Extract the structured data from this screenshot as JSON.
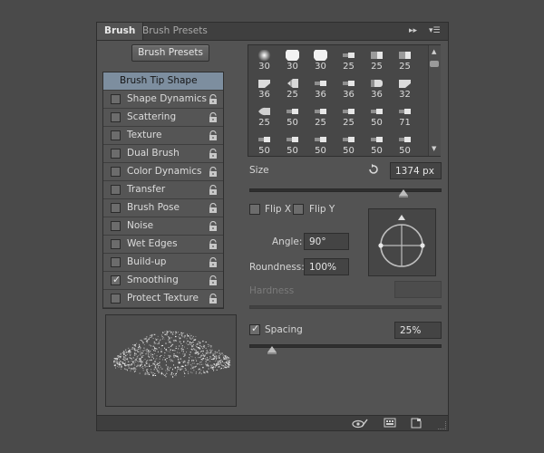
{
  "tabs": [
    {
      "label": "Brush",
      "active": true
    },
    {
      "label": "Brush Presets",
      "active": false
    }
  ],
  "panel_controls": {
    "collapse": "▸▸",
    "menu": "▾☰"
  },
  "brush_presets_button": "Brush Presets",
  "options": [
    {
      "label": "Brush Tip Shape",
      "selected": true,
      "checkbox": false,
      "checked": false,
      "lock": false
    },
    {
      "label": "Shape Dynamics",
      "selected": false,
      "checkbox": true,
      "checked": false,
      "lock": true
    },
    {
      "label": "Scattering",
      "selected": false,
      "checkbox": true,
      "checked": false,
      "lock": true
    },
    {
      "label": "Texture",
      "selected": false,
      "checkbox": true,
      "checked": false,
      "lock": true
    },
    {
      "label": "Dual Brush",
      "selected": false,
      "checkbox": true,
      "checked": false,
      "lock": true
    },
    {
      "label": "Color Dynamics",
      "selected": false,
      "checkbox": true,
      "checked": false,
      "lock": true
    },
    {
      "label": "Transfer",
      "selected": false,
      "checkbox": true,
      "checked": false,
      "lock": true
    },
    {
      "label": "Brush Pose",
      "selected": false,
      "checkbox": true,
      "checked": false,
      "lock": true
    },
    {
      "label": "Noise",
      "selected": false,
      "checkbox": true,
      "checked": false,
      "lock": true
    },
    {
      "label": "Wet Edges",
      "selected": false,
      "checkbox": true,
      "checked": false,
      "lock": true
    },
    {
      "label": "Build-up",
      "selected": false,
      "checkbox": true,
      "checked": false,
      "lock": true
    },
    {
      "label": "Smoothing",
      "selected": false,
      "checkbox": true,
      "checked": true,
      "lock": true
    },
    {
      "label": "Protect Texture",
      "selected": false,
      "checkbox": true,
      "checked": false,
      "lock": true
    }
  ],
  "brush_grid": {
    "rows": [
      [
        {
          "size": "30",
          "tip": "soft-round"
        },
        {
          "size": "30",
          "tip": "hard-round"
        },
        {
          "size": "30",
          "tip": "hard-round"
        },
        {
          "size": "25",
          "tip": "bristle-flat"
        },
        {
          "size": "25",
          "tip": "bristle-fan"
        },
        {
          "size": "25",
          "tip": "bristle-fan"
        }
      ],
      [
        {
          "size": "36",
          "tip": "bristle-angle"
        },
        {
          "size": "25",
          "tip": "bristle-fan-wide"
        },
        {
          "size": "36",
          "tip": "bristle-flat"
        },
        {
          "size": "36",
          "tip": "bristle-flat"
        },
        {
          "size": "36",
          "tip": "bristle-round"
        },
        {
          "size": "32",
          "tip": "bristle-angle"
        }
      ],
      [
        {
          "size": "25",
          "tip": "bristle-curve"
        },
        {
          "size": "50",
          "tip": "bristle-flat"
        },
        {
          "size": "25",
          "tip": "bristle-flat"
        },
        {
          "size": "25",
          "tip": "bristle-flat"
        },
        {
          "size": "50",
          "tip": "bristle-flat"
        },
        {
          "size": "71",
          "tip": "bristle-flat"
        }
      ],
      [
        {
          "size": "50",
          "tip": "bristle-flat"
        },
        {
          "size": "50",
          "tip": "bristle-flat"
        },
        {
          "size": "50",
          "tip": "bristle-flat"
        },
        {
          "size": "50",
          "tip": "bristle-flat"
        },
        {
          "size": "50",
          "tip": "bristle-flat"
        },
        {
          "size": "50",
          "tip": "bristle-flat"
        }
      ]
    ]
  },
  "size": {
    "label": "Size",
    "value": "1374 px",
    "reset_icon": "reset-arrow-icon",
    "slider_fraction": 0.8
  },
  "flip": {
    "x_label": "Flip X",
    "y_label": "Flip Y",
    "x_checked": false,
    "y_checked": false
  },
  "angle": {
    "label": "Angle:",
    "value": "90°"
  },
  "roundness": {
    "label": "Roundness:",
    "value": "100%"
  },
  "hardness": {
    "label": "Hardness",
    "value": ""
  },
  "spacing": {
    "label": "Spacing",
    "value": "25%",
    "checked": true,
    "slider_fraction": 0.12
  },
  "footer_icons": [
    "eye-brush-icon",
    "keyboard-grid-icon",
    "new-page-icon"
  ]
}
